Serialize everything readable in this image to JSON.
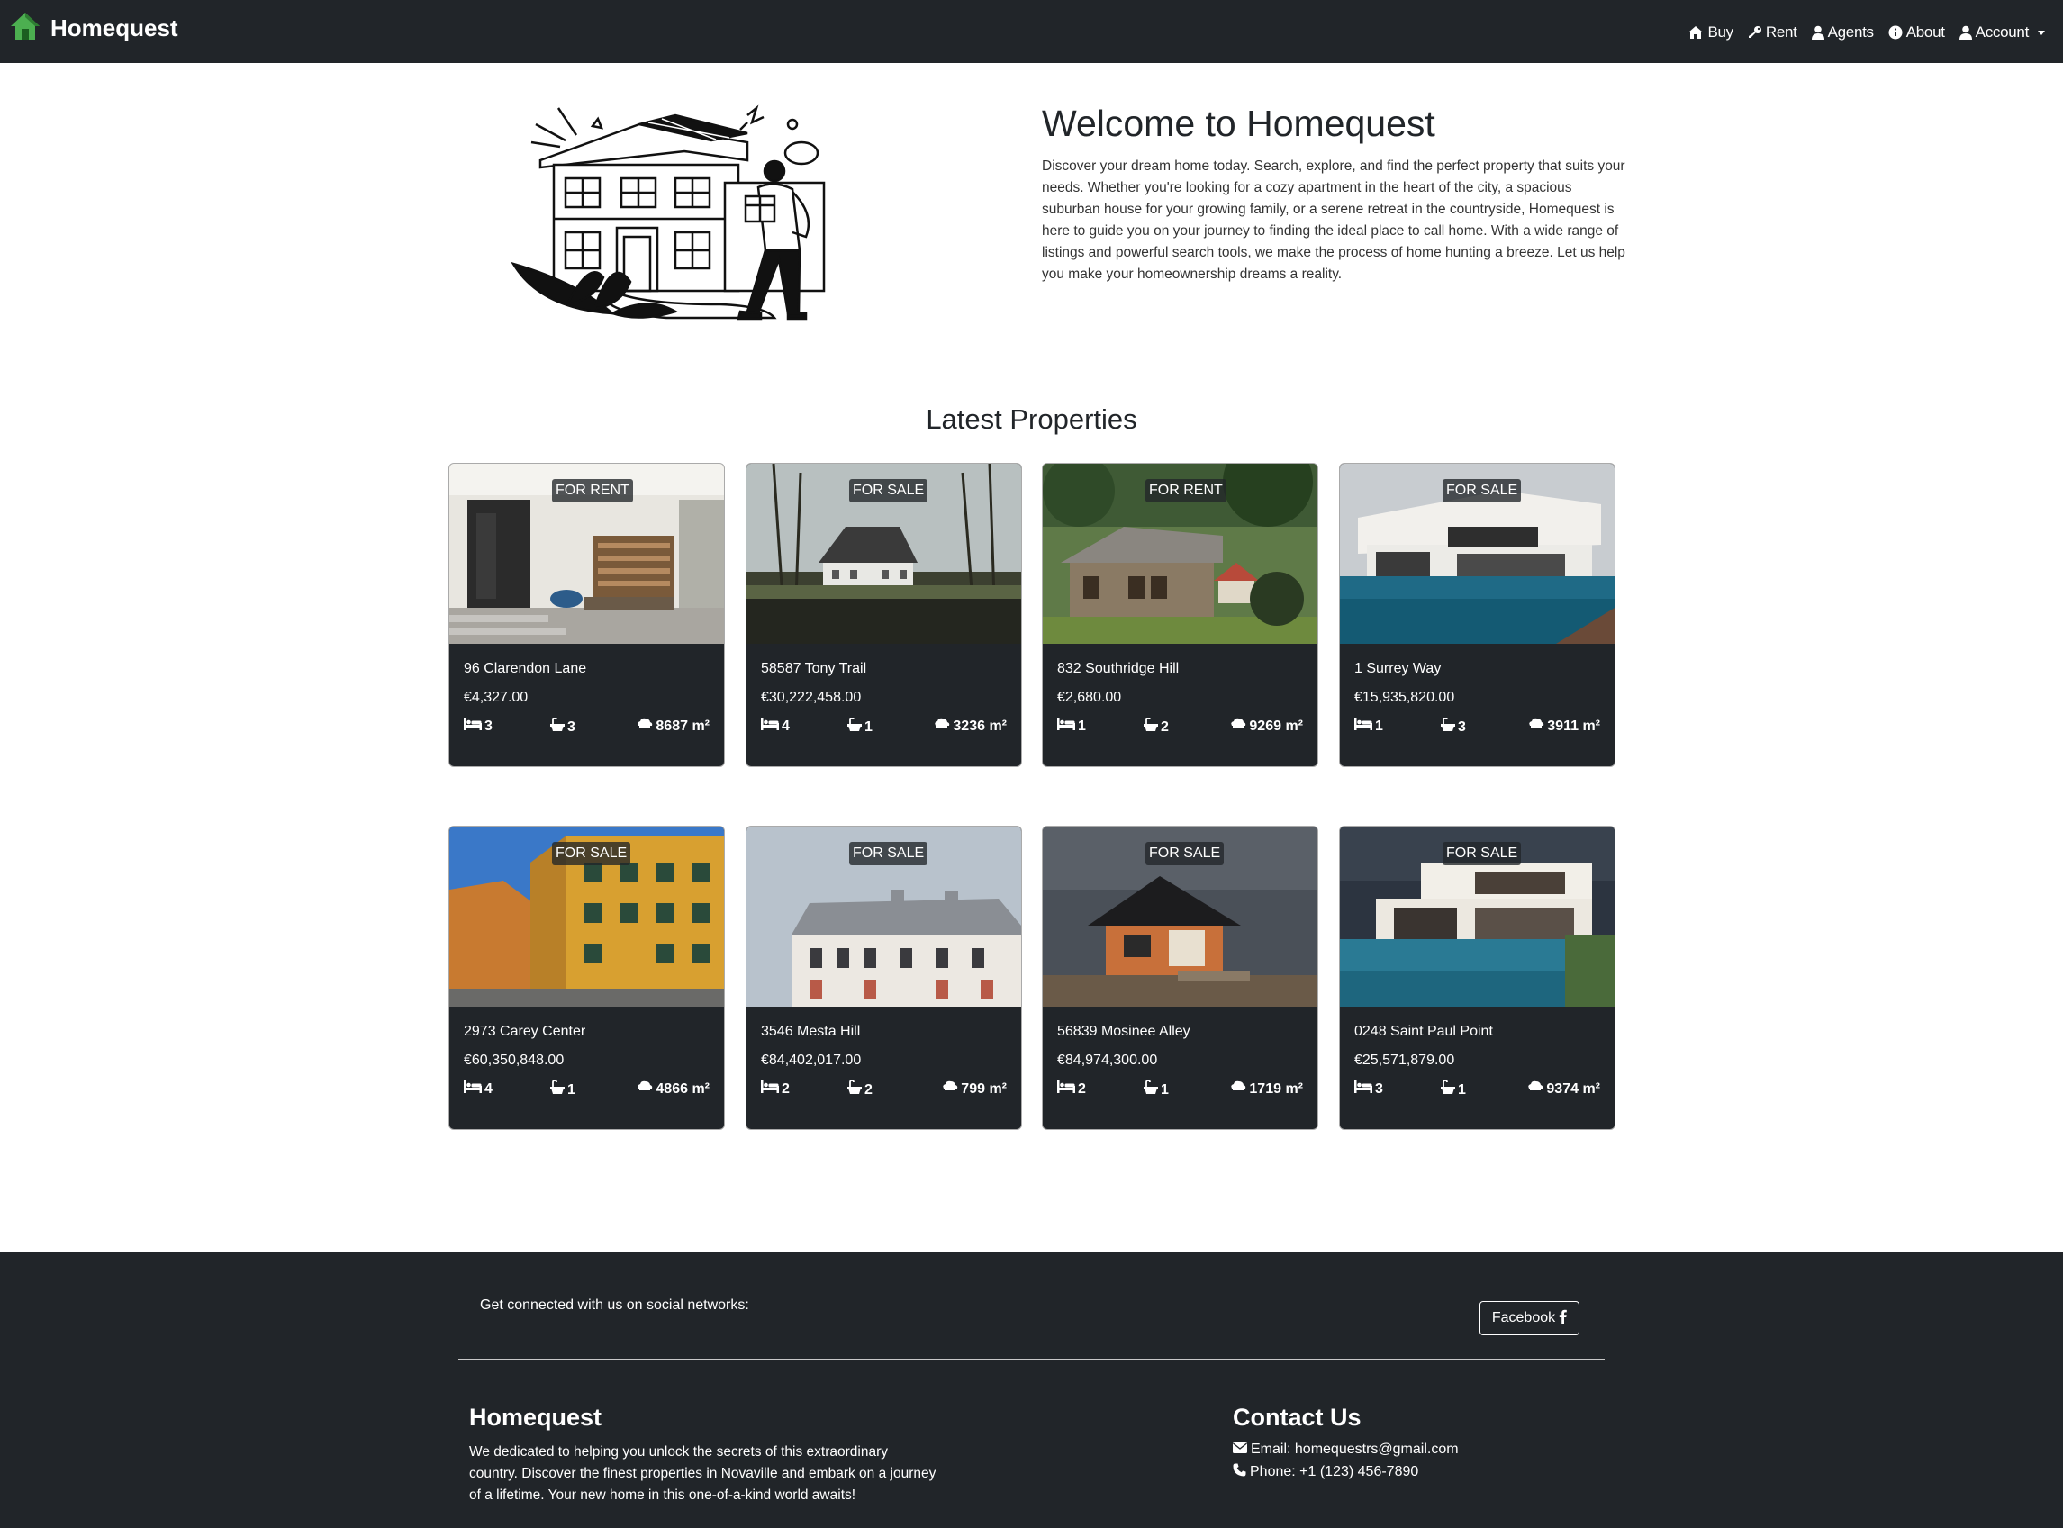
{
  "brand": {
    "name": "Homequest"
  },
  "nav": {
    "items": [
      {
        "label": "Buy",
        "icon": "home-icon"
      },
      {
        "label": "Rent",
        "icon": "key-icon"
      },
      {
        "label": "Agents",
        "icon": "user-icon"
      },
      {
        "label": "About",
        "icon": "info-icon"
      },
      {
        "label": "Account",
        "icon": "user-icon"
      }
    ]
  },
  "hero": {
    "title": "Welcome to Homequest",
    "text": "Discover your dream home today. Search, explore, and find the perfect property that suits your needs. Whether you're looking for a cozy apartment in the heart of the city, a spacious suburban house for your growing family, or a serene retreat in the countryside, Homequest is here to guide you on your journey to finding the ideal place to call home. With a wide range of listings and powerful search tools, we make the process of home hunting a breeze. Let us help you make your homeownership dreams a reality."
  },
  "latest": {
    "title": "Latest Properties",
    "properties": [
      {
        "badge": "FOR RENT",
        "address": "96 Clarendon Lane",
        "price": "€4,327.00",
        "beds": "3",
        "baths": "3",
        "area": "8687 m²"
      },
      {
        "badge": "FOR SALE",
        "address": "58587 Tony Trail",
        "price": "€30,222,458.00",
        "beds": "4",
        "baths": "1",
        "area": "3236 m²"
      },
      {
        "badge": "FOR RENT",
        "address": "832 Southridge Hill",
        "price": "€2,680.00",
        "beds": "1",
        "baths": "2",
        "area": "9269 m²"
      },
      {
        "badge": "FOR SALE",
        "address": "1 Surrey Way",
        "price": "€15,935,820.00",
        "beds": "1",
        "baths": "3",
        "area": "3911 m²"
      },
      {
        "badge": "FOR SALE",
        "address": "2973 Carey Center",
        "price": "€60,350,848.00",
        "beds": "4",
        "baths": "1",
        "area": "4866 m²"
      },
      {
        "badge": "FOR SALE",
        "address": "3546 Mesta Hill",
        "price": "€84,402,017.00",
        "beds": "2",
        "baths": "2",
        "area": "799 m²"
      },
      {
        "badge": "FOR SALE",
        "address": "56839 Mosinee Alley",
        "price": "€84,974,300.00",
        "beds": "2",
        "baths": "1",
        "area": "1719 m²"
      },
      {
        "badge": "FOR SALE",
        "address": "0248 Saint Paul Point",
        "price": "€25,571,879.00",
        "beds": "3",
        "baths": "1",
        "area": "9374 m²"
      }
    ]
  },
  "footer": {
    "social_text": "Get connected with us on social networks:",
    "facebook_label": "Facebook",
    "brand": "Homequest",
    "description": "We dedicated to helping you unlock the secrets of this extraordinary country. Discover the finest properties in Novaville and embark on a journey of a lifetime. Your new home in this one-of-a-kind world awaits!",
    "contact_title": "Contact Us",
    "email": "Email: homequestrs@gmail.com",
    "phone": "Phone: +1 (123) 456-7890"
  }
}
